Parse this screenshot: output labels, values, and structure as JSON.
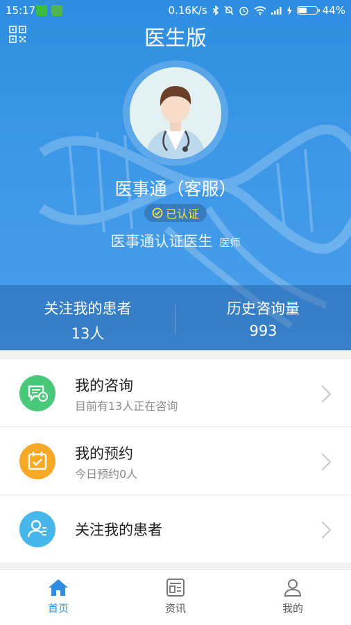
{
  "status_bar": {
    "time": "15:17",
    "network_speed": "0.16K/s",
    "battery": "44%"
  },
  "header": {
    "title": "医生版"
  },
  "profile": {
    "name": "医事通（客服）",
    "verified_label": "已认证",
    "organization": "医事通认证医生",
    "role": "医师"
  },
  "stats": [
    {
      "label": "关注我的患者",
      "value": "13人"
    },
    {
      "label": "历史咨询量",
      "value": "993"
    }
  ],
  "menu": [
    {
      "title": "我的咨询",
      "subtitle": "目前有13人正在咨询",
      "icon": "chat-clock-icon",
      "color": "#48c878"
    },
    {
      "title": "我的预约",
      "subtitle": "今日预约0人",
      "icon": "calendar-check-icon",
      "color": "#f7a826"
    },
    {
      "title": "关注我的患者",
      "subtitle": "",
      "icon": "patient-heart-icon",
      "color": "#47b6ea"
    }
  ],
  "tabs": [
    {
      "label": "首页",
      "icon": "home-icon",
      "active": true
    },
    {
      "label": "资讯",
      "icon": "news-icon",
      "active": false
    },
    {
      "label": "我的",
      "icon": "profile-icon",
      "active": false
    }
  ],
  "colors": {
    "primary": "#2f8ee0",
    "consult": "#48c878",
    "appointment": "#f7a826",
    "patients": "#47b6ea"
  }
}
